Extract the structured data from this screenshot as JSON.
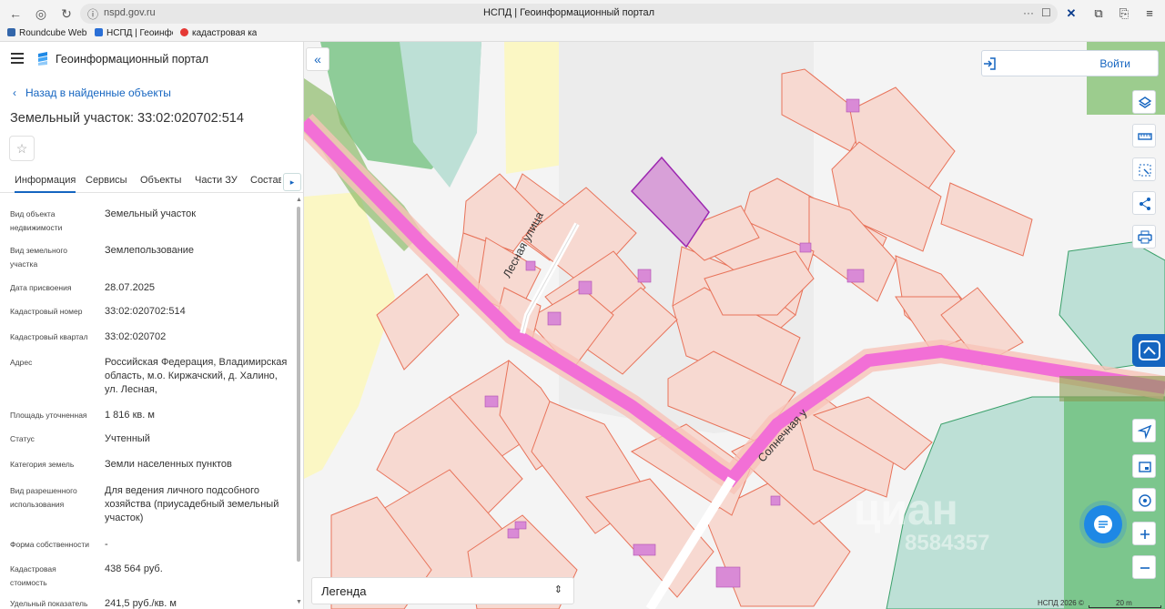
{
  "browser": {
    "url": "nspd.gov.ru",
    "tab_title": "НСПД | Геоинформационный портал",
    "bookmarks": [
      "Roundcube Webm",
      "НСПД | Геоинфор",
      "кадастровая карт"
    ]
  },
  "header": {
    "portal_title": "Геоинформационный портал"
  },
  "panel": {
    "back_label": "Назад в найденные объекты",
    "object_title": "Земельный участок: 33:02:020702:514",
    "tabs": [
      "Информация",
      "Сервисы",
      "Объекты",
      "Части ЗУ",
      "Состав"
    ],
    "active_tab": "Информация",
    "rows": [
      {
        "label": "Вид объекта недвижимости",
        "value": "Земельный участок"
      },
      {
        "label": "Вид земельного участка",
        "value": "Землепользование"
      },
      {
        "label": "Дата присвоения",
        "value": "28.07.2025"
      },
      {
        "label": "Кадастровый номер",
        "value": "33:02:020702:514"
      },
      {
        "label": "Кадастровый квартал",
        "value": "33:02:020702"
      },
      {
        "label": "Адрес",
        "value": "Российская Федерация, Владимирская область, м.о. Киржачский, д. Халино, ул. Лесная,"
      },
      {
        "label": "Площадь уточненная",
        "value": "1 816 кв. м"
      },
      {
        "label": "Статус",
        "value": "Учтенный"
      },
      {
        "label": "Категория земель",
        "value": "Земли населенных пунктов"
      },
      {
        "label": "Вид разрешенного использования",
        "value": "Для ведения личного подсобного хозяйства (приусадебный земельный участок)"
      },
      {
        "label": "Форма собственности",
        "value": "-"
      },
      {
        "label": "Кадастровая стоимость",
        "value": "438 564 руб."
      },
      {
        "label": "Удельный показатель",
        "value": "241,5 руб./кв. м"
      }
    ]
  },
  "map": {
    "login_label": "Войти",
    "street_1": "Лесная улица",
    "street_2": "Солнечная у",
    "legend_label": "Легенда",
    "copyright": "НСПД 2026 ©",
    "scale": "20 m",
    "watermark_1": "циан",
    "watermark_2": "8584357",
    "colors": {
      "road": "#f26fd6",
      "parcel_fill": "#f7d9d1",
      "parcel_stroke": "#e8735a",
      "forest": "#6cbf7a",
      "water": "#bde0d6",
      "field": "#fbf7c4",
      "selected_parcel": "#d8a0d8",
      "accent": "#1565c0"
    }
  }
}
